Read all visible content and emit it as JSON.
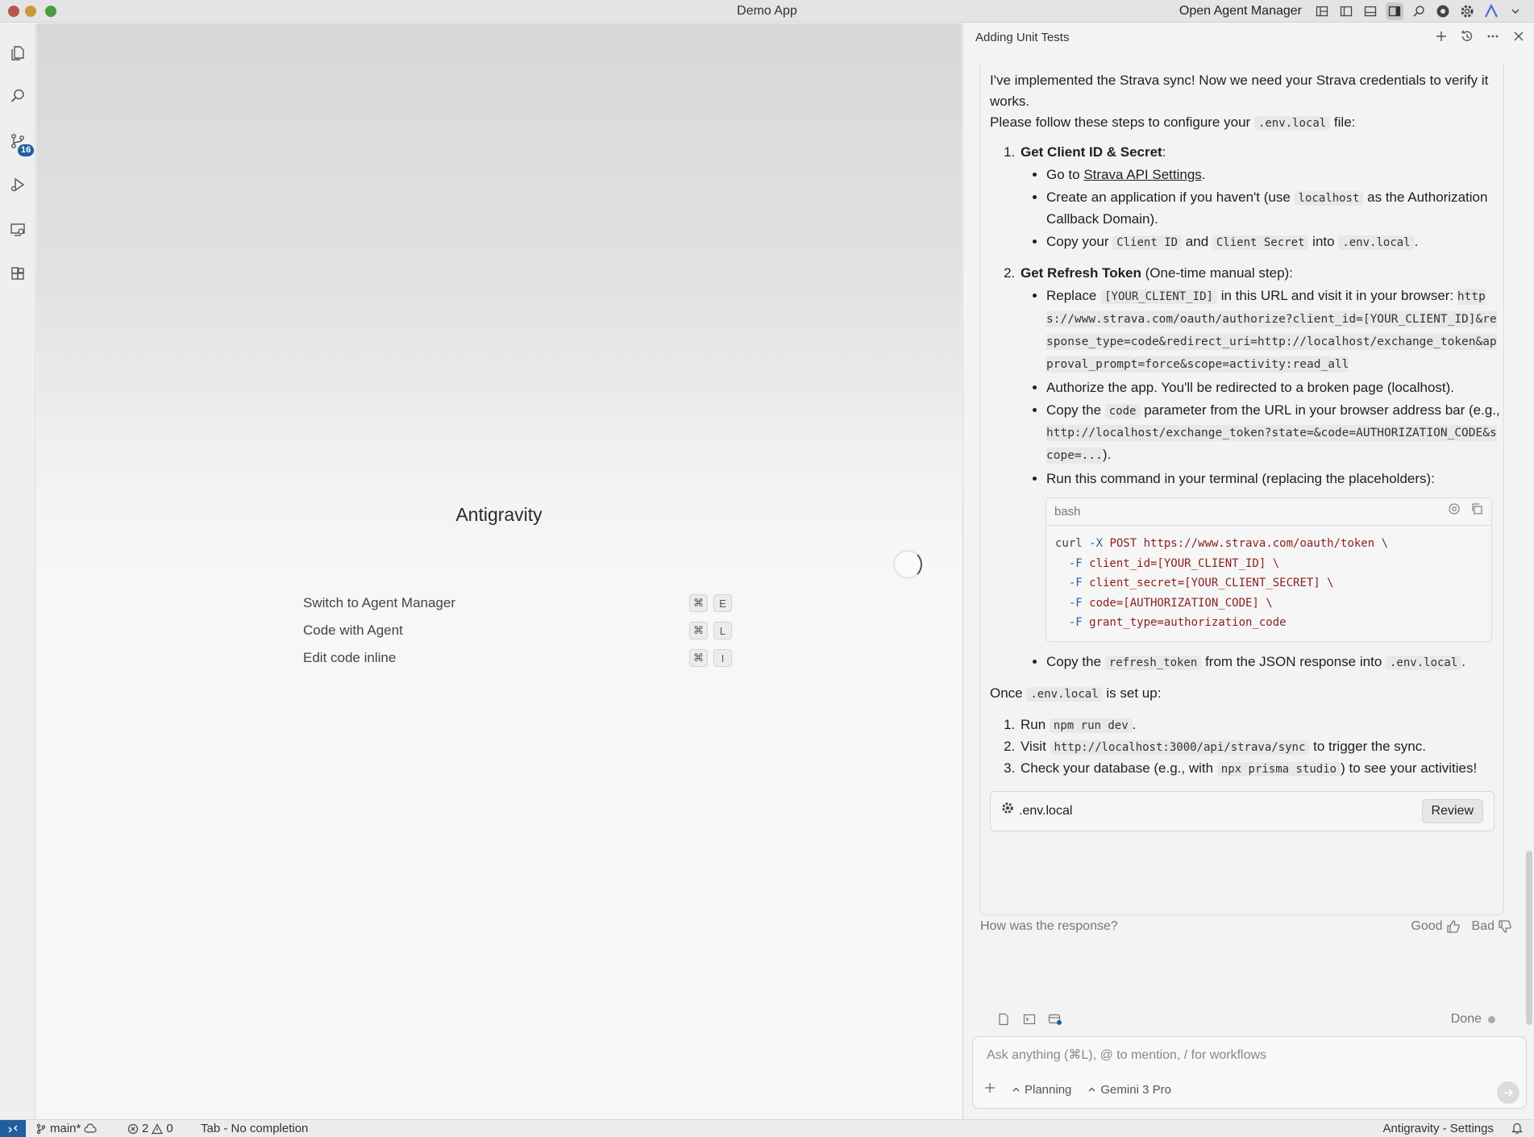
{
  "window": {
    "title": "Demo App",
    "open_agent_manager": "Open Agent Manager"
  },
  "activity": {
    "scm_badge": "16"
  },
  "editor": {
    "brand": "Antigravity",
    "shortcuts": [
      {
        "label": "Switch to Agent Manager",
        "mod": "⌘",
        "key": "E"
      },
      {
        "label": "Code with Agent",
        "mod": "⌘",
        "key": "L"
      },
      {
        "label": "Edit code inline",
        "mod": "⌘",
        "key": "I"
      }
    ]
  },
  "panel": {
    "title": "Adding Unit Tests",
    "intro_1": "I've implemented the Strava sync! Now we need your Strava credentials to verify it works.",
    "intro_2a": "Please follow these steps to configure your ",
    "intro_2_code": ".env.local",
    "intro_2b": " file:",
    "step1": {
      "title": "Get Client ID & Secret",
      "title_suffix": ":",
      "b1_pre": "Go to ",
      "b1_link": "Strava API Settings",
      "b1_post": ".",
      "b2_pre": "Create an application if you haven't (use ",
      "b2_code": "localhost",
      "b2_post": " as the Authorization Callback Domain).",
      "b3_pre": "Copy your ",
      "b3_code1": "Client ID",
      "b3_mid": " and ",
      "b3_code2": "Client Secret",
      "b3_mid2": " into ",
      "b3_code3": ".env.local",
      "b3_post": "."
    },
    "step2": {
      "title": "Get Refresh Token",
      "title_suffix": " (One-time manual step):",
      "b1_pre": "Replace ",
      "b1_code": "[YOUR_CLIENT_ID]",
      "b1_mid": " in this URL and visit it in your browser: ",
      "b1_url": "https://www.strava.com/oauth/authorize?client_id=[YOUR_CLIENT_ID]&response_type=code&redirect_uri=http://localhost/exchange_token&approval_prompt=force&scope=activity:read_all",
      "b2": "Authorize the app. You'll be redirected to a broken page (localhost).",
      "b3_pre": "Copy the ",
      "b3_code": "code",
      "b3_mid": " parameter from the URL in your browser address bar (e.g., ",
      "b3_url": "http://localhost/exchange_token?state=&code=AUTHORIZATION_CODE&scope=...",
      "b3_post": ").",
      "b4": "Run this command in your terminal (replacing the placeholders):",
      "code_lang": "bash",
      "code_lines": [
        {
          "cmd": "curl",
          "flag": " -X",
          "rest": " POST https://www.strava.com/oauth/token \\"
        },
        {
          "cmd": "  ",
          "flag": "-F",
          "rest": " client_id=[YOUR_CLIENT_ID] \\"
        },
        {
          "cmd": "  ",
          "flag": "-F",
          "rest": " client_secret=[YOUR_CLIENT_SECRET] \\"
        },
        {
          "cmd": "  ",
          "flag": "-F",
          "rest": " code=[AUTHORIZATION_CODE] \\"
        },
        {
          "cmd": "  ",
          "flag": "-F",
          "rest": " grant_type=authorization_code"
        }
      ],
      "b5_pre": "Copy the ",
      "b5_code": "refresh_token",
      "b5_mid": " from the JSON response into ",
      "b5_code2": ".env.local",
      "b5_post": "."
    },
    "once_pre": "Once ",
    "once_code": ".env.local",
    "once_post": " is set up:",
    "final": {
      "s1_pre": "Run ",
      "s1_code": "npm run dev",
      "s1_post": ".",
      "s2_pre": "Visit ",
      "s2_code": "http://localhost:3000/api/strava/sync",
      "s2_post": " to trigger the sync.",
      "s3_pre": "Check your database (e.g., with ",
      "s3_code": "npx prisma studio",
      "s3_post": ") to see your activities!"
    },
    "file_card": {
      "name": ".env.local",
      "review": "Review"
    },
    "feedback": {
      "question": "How was the response?",
      "good": "Good",
      "bad": "Bad"
    },
    "done": "Done",
    "chat": {
      "placeholder": "Ask anything (⌘L), @ to mention, / for workflows",
      "mode": "Planning",
      "model": "Gemini 3 Pro"
    }
  },
  "status": {
    "branch": "main*",
    "errors": "2",
    "warnings": "0",
    "completion": "Tab - No completion",
    "settings": "Antigravity - Settings"
  }
}
